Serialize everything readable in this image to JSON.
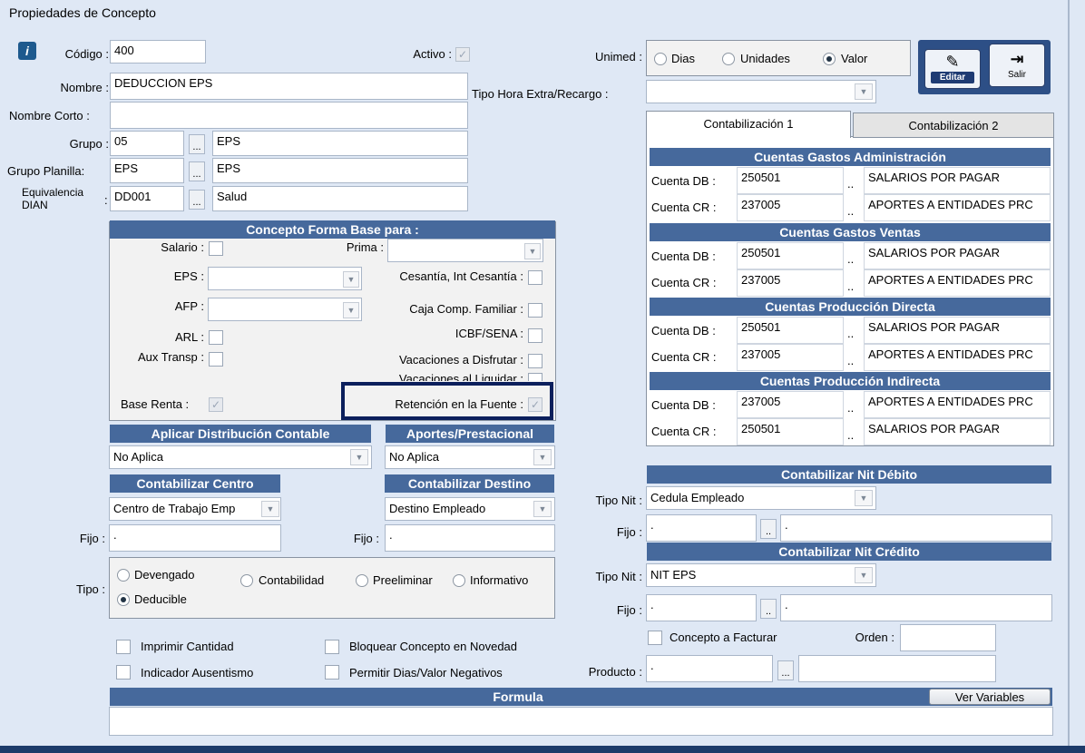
{
  "window": {
    "title": "Propiedades de Concepto"
  },
  "general": {
    "codigo_label": "Código :",
    "codigo_value": "400",
    "activo_label": "Activo :",
    "nombre_label": "Nombre :",
    "nombre_value": "DEDUCCION EPS",
    "nombre_corto_label": "Nombre Corto :",
    "nombre_corto_value": "",
    "grupo_label": "Grupo :",
    "grupo_code": "05",
    "grupo_desc": "EPS",
    "grupo_planilla_label": "Grupo Planilla:",
    "grupo_planilla_code": "EPS",
    "grupo_planilla_desc": "EPS",
    "equivalencia_label_1": "Equivalencia",
    "equivalencia_label_2": "DIAN",
    "equivalencia_colon": ":",
    "equivalencia_code": "DD001",
    "equivalencia_desc": "Salud",
    "dots": "..."
  },
  "unimed": {
    "label": "Unimed :",
    "options": [
      "Dias",
      "Unidades",
      "Valor"
    ],
    "selected": "Valor"
  },
  "tipo_hora": {
    "label": "Tipo Hora Extra/Recargo :",
    "value": ""
  },
  "toolbar": {
    "editar": "Editar",
    "salir": "Salir"
  },
  "base": {
    "header": "Concepto Forma Base para :",
    "salario": "Salario :",
    "prima": "Prima :",
    "eps": "EPS :",
    "cesantia": "Cesantía, Int Cesantía :",
    "afp": "AFP :",
    "caja": "Caja Comp. Familiar :",
    "arl": "ARL :",
    "icbf": "ICBF/SENA :",
    "aux": "Aux Transp :",
    "vac_disfrutar": "Vacaciones a Disfrutar :",
    "vac_liquidar": "Vacaciones al Liquidar :",
    "base_renta": "Base Renta :",
    "retencion": "Retención en la Fuente :"
  },
  "distribucion": {
    "header": "Aplicar Distribución Contable",
    "value": "No Aplica"
  },
  "aportes": {
    "header": "Aportes/Prestacional",
    "value": "No Aplica"
  },
  "centro": {
    "header": "Contabilizar Centro",
    "value": "Centro de Trabajo Emp",
    "fijo_label": "Fijo :",
    "fijo_value": "."
  },
  "destino": {
    "header": "Contabilizar Destino",
    "value": "Destino Empleado",
    "fijo_label": "Fijo :",
    "fijo_value": "."
  },
  "tipo": {
    "label": "Tipo :",
    "options": [
      "Devengado",
      "Contabilidad",
      "Preeliminar",
      "Informativo",
      "Deducible"
    ],
    "selected": "Deducible"
  },
  "flags": {
    "imprimir": "Imprimir Cantidad",
    "ausentismo": "Indicador Ausentismo",
    "bloquear": "Bloquear Concepto en Novedad",
    "negativos": "Permitir Dias/Valor Negativos"
  },
  "tabs": [
    "Contabilización 1",
    "Contabilización 2"
  ],
  "cuentas": [
    {
      "header": "Cuentas Gastos Administración",
      "db_label": "Cuenta DB :",
      "db_code": "250501",
      "db_desc": "SALARIOS POR PAGAR",
      "cr_label": "Cuenta CR :",
      "cr_code": "237005",
      "cr_desc": "APORTES A ENTIDADES PRC"
    },
    {
      "header": "Cuentas Gastos Ventas",
      "db_label": "Cuenta DB :",
      "db_code": "250501",
      "db_desc": "SALARIOS POR PAGAR",
      "cr_label": "Cuenta CR :",
      "cr_code": "237005",
      "cr_desc": "APORTES A ENTIDADES PRC"
    },
    {
      "header": "Cuentas Producción Directa",
      "db_label": "Cuenta DB :",
      "db_code": "250501",
      "db_desc": "SALARIOS POR PAGAR",
      "cr_label": "Cuenta CR :",
      "cr_code": "237005",
      "cr_desc": "APORTES A ENTIDADES PRC"
    },
    {
      "header": "Cuentas Producción Indirecta",
      "db_label": "Cuenta DB :",
      "db_code": "237005",
      "db_desc": "APORTES A ENTIDADES PRC",
      "cr_label": "Cuenta CR :",
      "cr_code": "250501",
      "cr_desc": "SALARIOS POR PAGAR"
    }
  ],
  "cuentas_dots": "..",
  "nit_debito": {
    "header": "Contabilizar Nit Débito",
    "tipo_label": "Tipo Nit :",
    "tipo_value": "Cedula Empleado",
    "fijo_label": "Fijo :",
    "fijo_code": ".",
    "fijo_desc": "."
  },
  "nit_credito": {
    "header": "Contabilizar Nit Crédito",
    "tipo_label": "Tipo Nit :",
    "tipo_value": "NIT EPS",
    "fijo_label": "Fijo :",
    "fijo_code": ".",
    "fijo_desc": "."
  },
  "facturar": {
    "label": "Concepto a Facturar",
    "orden_label": "Orden :",
    "orden_value": ""
  },
  "producto": {
    "label": "Producto :",
    "code": ".",
    "desc": ""
  },
  "formula": {
    "header": "Formula",
    "ver_variables": "Ver Variables",
    "value": ""
  }
}
